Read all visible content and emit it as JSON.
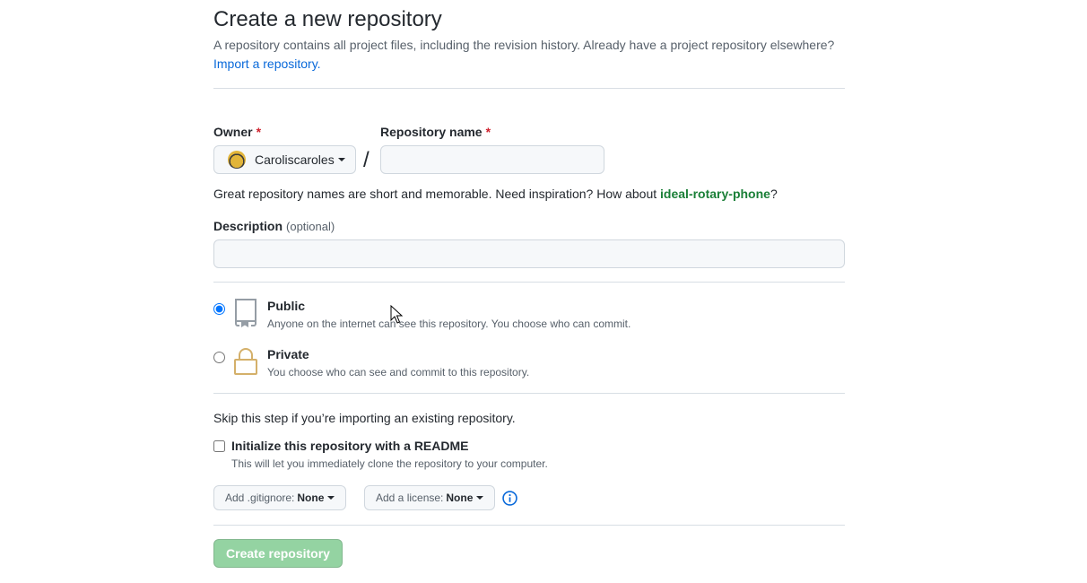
{
  "header": {
    "title": "Create a new repository",
    "subtitle": "A repository contains all project files, including the revision history. Already have a project repository elsewhere?",
    "import_link": "Import a repository."
  },
  "owner": {
    "label": "Owner",
    "required_mark": "*",
    "value": "Caroliscaroles",
    "avatar_icon": "user-avatar-icon"
  },
  "repo_name": {
    "label": "Repository name",
    "required_mark": "*",
    "value": "",
    "separator": "/"
  },
  "name_hint": {
    "text": "Great repository names are short and memorable. Need inspiration? How about ",
    "suggestion": "ideal-rotary-phone",
    "suffix": "?"
  },
  "description": {
    "label": "Description",
    "optional": "(optional)",
    "value": ""
  },
  "visibility": {
    "selected": "public",
    "options": [
      {
        "id": "public",
        "title": "Public",
        "desc": "Anyone on the internet can see this repository. You choose who can commit.",
        "icon": "repo-icon"
      },
      {
        "id": "private",
        "title": "Private",
        "desc": "You choose who can see and commit to this repository.",
        "icon": "lock-icon"
      }
    ]
  },
  "init": {
    "skip_text": "Skip this step if you’re importing an existing repository.",
    "readme_label": "Initialize this repository with a README",
    "readme_desc": "This will let you immediately clone the repository to your computer.",
    "readme_checked": false,
    "gitignore_label": "Add .gitignore:",
    "gitignore_value": "None",
    "license_label": "Add a license:",
    "license_value": "None",
    "info_icon": "info-icon"
  },
  "submit": {
    "label": "Create repository",
    "disabled": true
  },
  "colors": {
    "link": "#0969da",
    "required": "#cf222e",
    "suggestion": "#1a7f37",
    "button_disabled": "#94d3a2"
  }
}
